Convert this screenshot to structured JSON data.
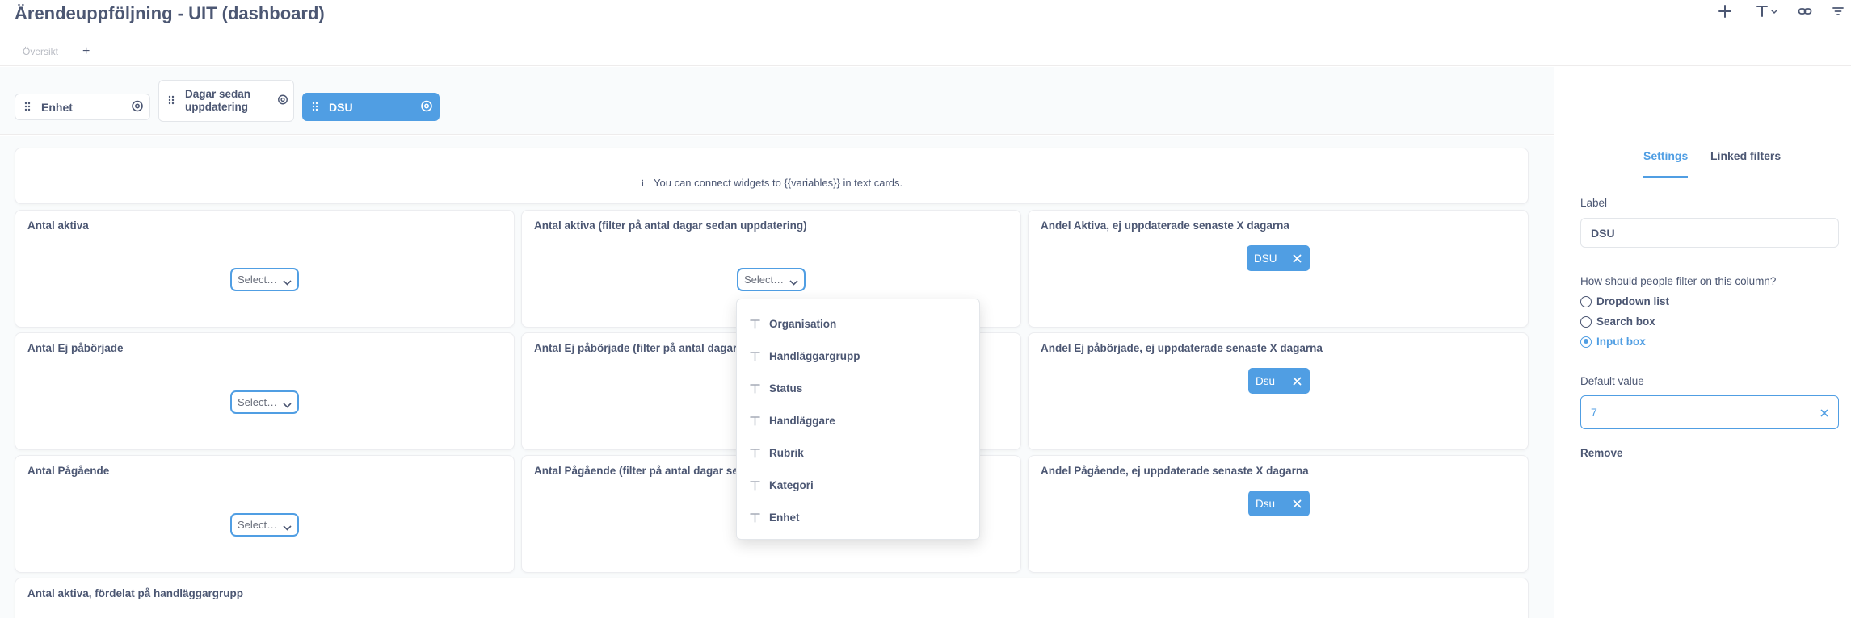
{
  "header": {
    "title": "Ärendeuppföljning - UIT (dashboard)",
    "tabs": [
      "Översikt"
    ],
    "add_tab_label": "+",
    "icons": [
      "plus-icon",
      "text-format-icon",
      "link-icon",
      "filter-icon"
    ]
  },
  "filters": [
    {
      "label": "Enhet",
      "active": false
    },
    {
      "label": "Dagar sedan uppdatering",
      "active": false
    },
    {
      "label": "DSU",
      "active": true
    }
  ],
  "info_card": {
    "text": "You can connect widgets to {{variables}} in text cards."
  },
  "cards": {
    "r1c1": {
      "title": "Antal aktiva",
      "select": "Select…"
    },
    "r1c2": {
      "title": "Antal aktiva (filter på antal dagar sedan uppdatering)",
      "select": "Select…"
    },
    "r1c3": {
      "title": "Andel Aktiva, ej uppdaterade senaste X dagarna",
      "pill": "DSU"
    },
    "r2c1": {
      "title": "Antal Ej påbörjade",
      "select": "Select…"
    },
    "r2c2": {
      "title": "Antal Ej påbörjade (filter på antal dagar s"
    },
    "r2c3": {
      "title": "Andel Ej påbörjade, ej uppdaterade senaste X dagarna",
      "pill": "Dsu"
    },
    "r3c1": {
      "title": "Antal Pågående",
      "select": "Select…"
    },
    "r3c2": {
      "title": "Antal Pågående (filter på antal dagar sed"
    },
    "r3c3": {
      "title": "Andel Pågående, ej uppdaterade senaste X dagarna",
      "pill": "Dsu"
    },
    "r4c1": {
      "title": "Antal aktiva, fördelat på handläggargrupp"
    }
  },
  "dropdown": {
    "items": [
      "Organisation",
      "Handläggargrupp",
      "Status",
      "Handläggare",
      "Rubrik",
      "Kategori",
      "Enhet"
    ]
  },
  "sidebar": {
    "tabs": [
      "Settings",
      "Linked filters"
    ],
    "label_heading": "Label",
    "label_value": "DSU",
    "filter_question": "How should people filter on this column?",
    "filter_options": [
      "Dropdown list",
      "Search box",
      "Input box"
    ],
    "selected_option": "Input box",
    "default_heading": "Default value",
    "default_value": "7",
    "remove_label": "Remove"
  },
  "colors": {
    "accent": "#509ee3",
    "text": "#4c5773",
    "background": "#f9fbfc"
  }
}
